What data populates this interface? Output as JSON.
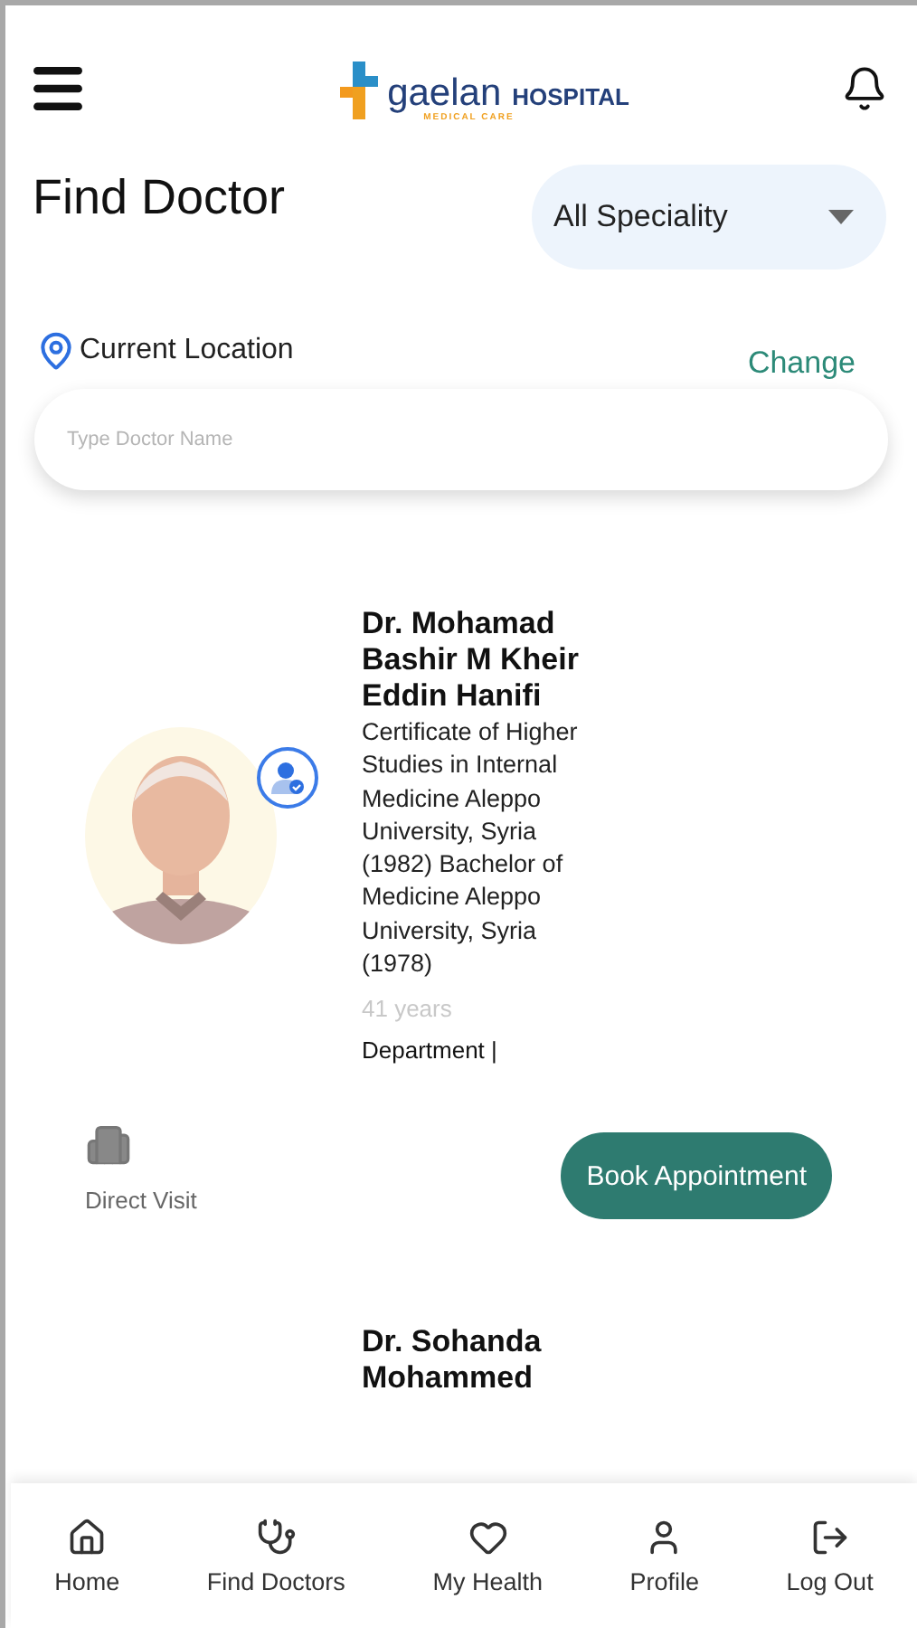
{
  "header": {
    "logo": {
      "name": "gaelan",
      "word": "HOSPITAL",
      "tagline": "MEDICAL CARE"
    }
  },
  "page_title": "Find Doctor",
  "speciality_dropdown": {
    "value": "All Speciality"
  },
  "location": {
    "label": "Current Location",
    "action": "Change"
  },
  "search": {
    "placeholder": "Type Doctor Name"
  },
  "doctors": [
    {
      "name": "Dr. Mohamad Bashir M Kheir Eddin Hanifi",
      "qualifications": "Certificate of Higher Studies in Internal Medicine Aleppo University, Syria (1982) Bachelor of Medicine Aleppo University, Syria (1978)",
      "experience": "41 years",
      "department": "Department |",
      "verified": true,
      "visit_type": "Direct Visit",
      "button": "Book Appointment"
    },
    {
      "name": "Dr. Sohanda Mohammed"
    }
  ],
  "bottom_nav": [
    {
      "label": "Home"
    },
    {
      "label": "Find Doctors"
    },
    {
      "label": "My Health"
    },
    {
      "label": "Profile"
    },
    {
      "label": "Log Out"
    }
  ]
}
